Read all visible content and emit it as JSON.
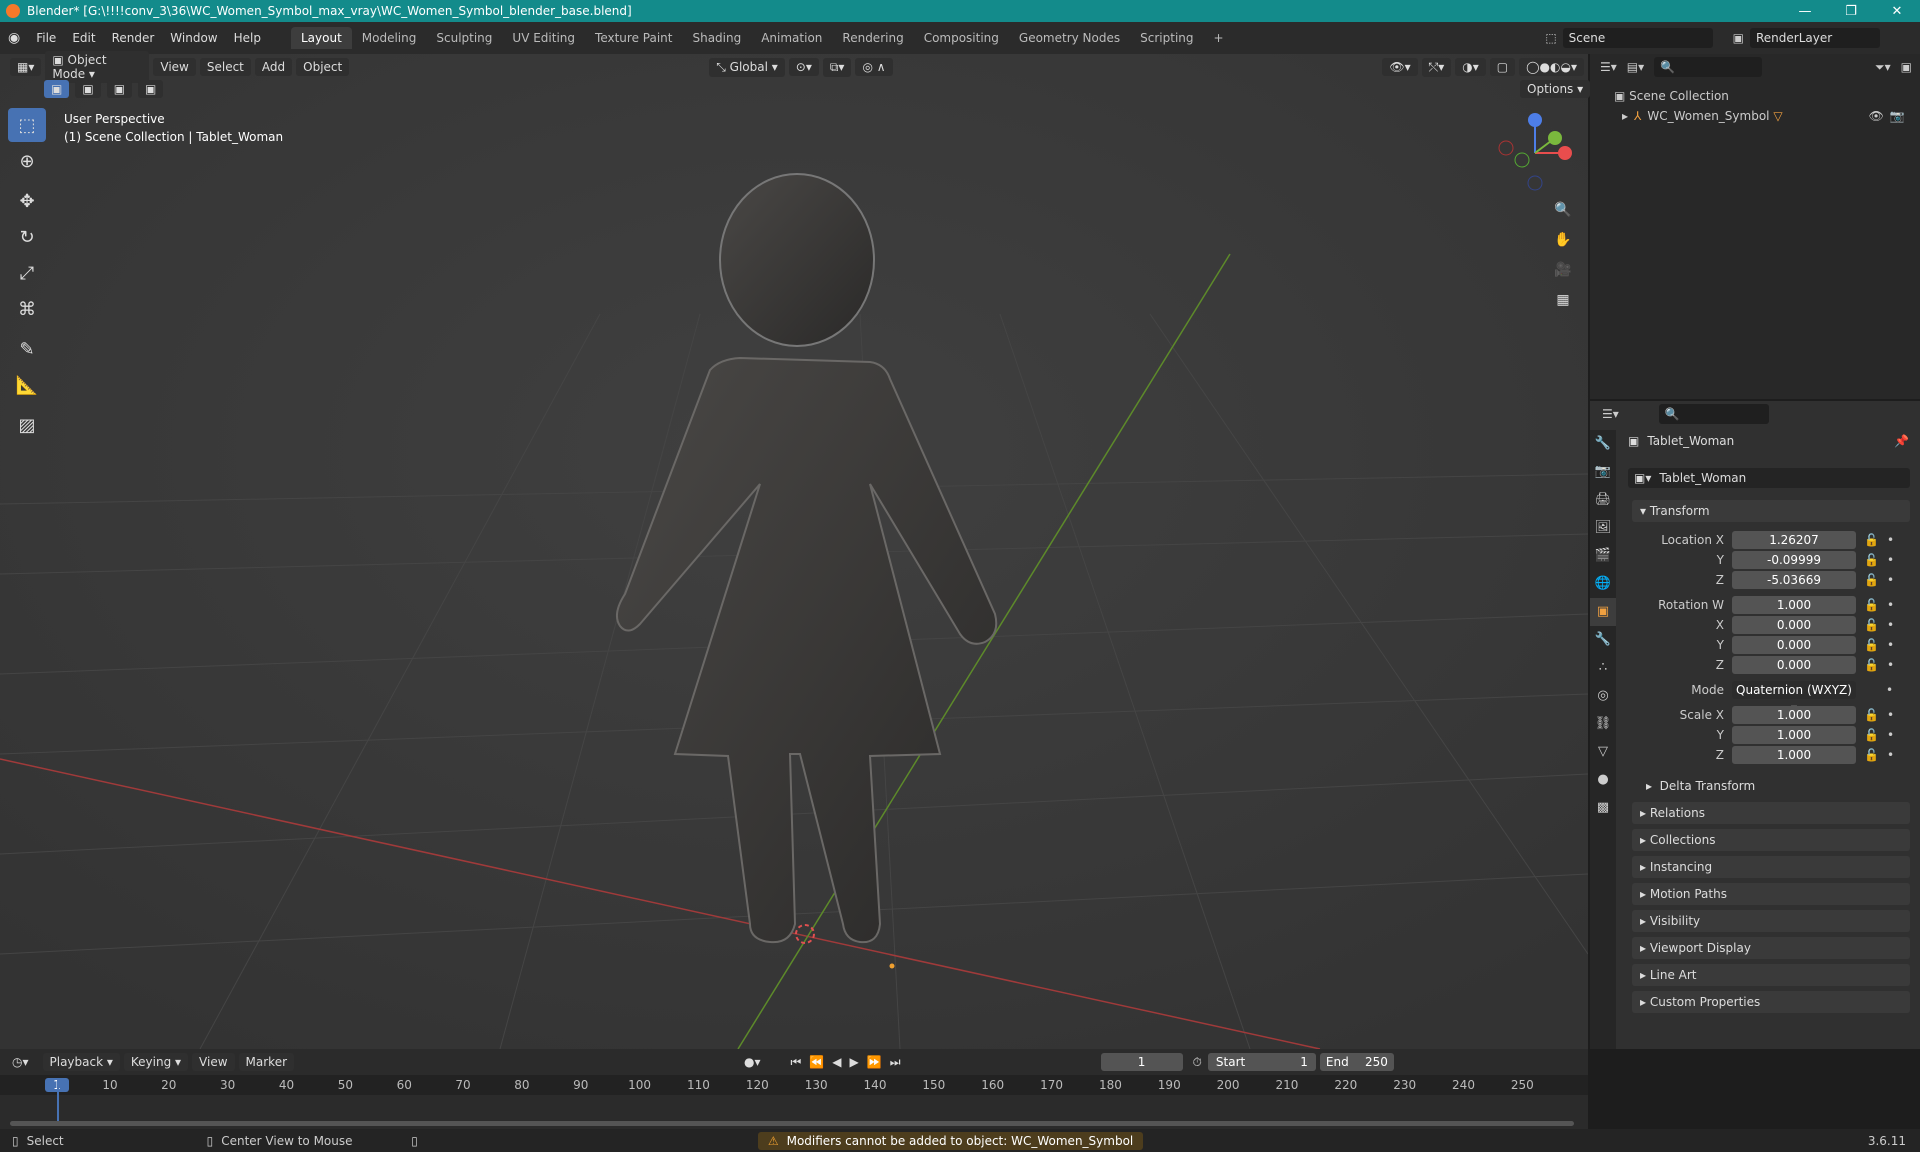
{
  "window": {
    "title": "Blender* [G:\\!!!!conv_3\\36\\WC_Women_Symbol_max_vray\\WC_Women_Symbol_blender_base.blend]"
  },
  "menus": [
    "File",
    "Edit",
    "Render",
    "Window",
    "Help"
  ],
  "workspaces": [
    "Layout",
    "Modeling",
    "Sculpting",
    "UV Editing",
    "Texture Paint",
    "Shading",
    "Animation",
    "Rendering",
    "Compositing",
    "Geometry Nodes",
    "Scripting"
  ],
  "scene": {
    "name": "Scene",
    "render_layer": "RenderLayer"
  },
  "viewport": {
    "mode": "Object Mode",
    "menus": [
      "View",
      "Select",
      "Add",
      "Object"
    ],
    "orientation": "Global",
    "options": "Options",
    "info_line1": "User Perspective",
    "info_line2": "(1) Scene Collection | Tablet_Woman"
  },
  "outliner": {
    "root": "Scene Collection",
    "item": "WC_Women_Symbol"
  },
  "properties": {
    "object_name": "Tablet_Woman",
    "data_name": "Tablet_Woman",
    "section": "Transform",
    "location": {
      "label": "Location X",
      "x": "1.26207",
      "y": "-0.09999",
      "z": "-5.03669"
    },
    "rotation": {
      "label": "Rotation W",
      "w": "1.000",
      "x": "0.000",
      "y": "0.000",
      "z": "0.000"
    },
    "mode_label": "Mode",
    "mode": "Quaternion (WXYZ)",
    "scale": {
      "label": "Scale X",
      "x": "1.000",
      "y": "1.000",
      "z": "1.000"
    },
    "axis_y": "Y",
    "axis_z": "Z",
    "axis_x": "X",
    "delta": "Delta Transform",
    "panels": [
      "Relations",
      "Collections",
      "Instancing",
      "Motion Paths",
      "Visibility",
      "Viewport Display",
      "Line Art",
      "Custom Properties"
    ]
  },
  "timeline": {
    "menus": [
      "Playback",
      "Keying",
      "View",
      "Marker"
    ],
    "current": "1",
    "start_label": "Start",
    "start": "1",
    "end_label": "End",
    "end": "250",
    "ticks": [
      "1",
      "10",
      "20",
      "30",
      "40",
      "50",
      "60",
      "70",
      "80",
      "90",
      "100",
      "110",
      "120",
      "130",
      "140",
      "150",
      "160",
      "170",
      "180",
      "190",
      "200",
      "210",
      "220",
      "230",
      "240",
      "250"
    ]
  },
  "status": {
    "select": "Select",
    "center": "Center View to Mouse",
    "warning": "Modifiers cannot be added to object: WC_Women_Symbol",
    "version": "3.6.11"
  }
}
